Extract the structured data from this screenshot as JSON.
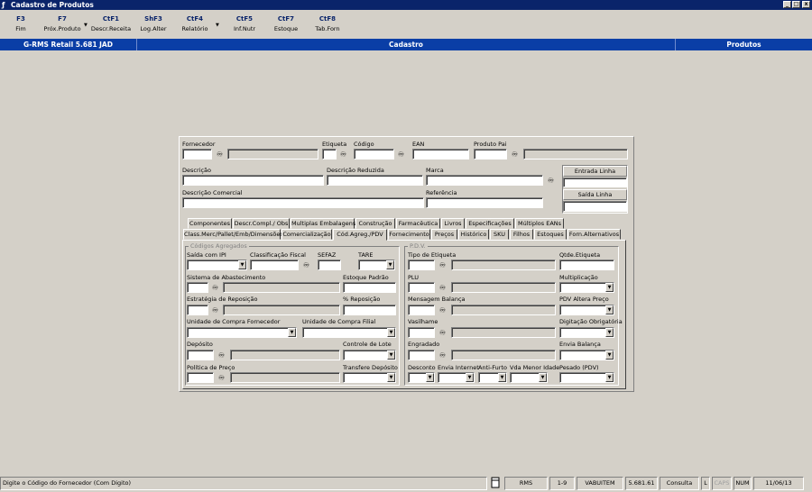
{
  "window": {
    "title": "Cadastro de Produtos",
    "btn_min": "_",
    "btn_max": "□",
    "btn_close": "x"
  },
  "toolbar": [
    {
      "key": "F3",
      "label": "Fim"
    },
    {
      "key": "F7",
      "label": "Próx.Produto"
    },
    {
      "key": "CtF1",
      "label": "Descr.Receita"
    },
    {
      "key": "ShF3",
      "label": "Log.Alter"
    },
    {
      "key": "CtF4",
      "label": "Relatório"
    },
    {
      "key": "CtF5",
      "label": "Inf.Nutr"
    },
    {
      "key": "CtF7",
      "label": "Estoque"
    },
    {
      "key": "CtF8",
      "label": "Tab.Forn"
    }
  ],
  "header": {
    "app": "G-RMS Retail 5.681 JAD",
    "screen": "Cadastro",
    "module": "Produtos"
  },
  "form": {
    "fornecedor": "Fornecedor",
    "etiqueta": "Etiqueta",
    "codigo": "Código",
    "ean": "EAN",
    "produto_pai": "Produto Pai",
    "descricao": "Descrição",
    "descricao_reduzida": "Descrição Reduzida",
    "marca": "Marca",
    "descricao_comercial": "Descrição Comercial",
    "referencia": "Referência",
    "entrada_linha": "Entrada Linha",
    "saida_linha": "Saída Linha"
  },
  "tabs_row1": [
    "Componentes",
    "Descr.Compl./ Obs",
    "Multiplas Embalagens",
    "Construção",
    "Farmacêutica",
    "Livros",
    "Especificações",
    "Múltiplos EANs"
  ],
  "tabs_row2": [
    "Class.Merc/Pallet/Emb/Dimensões",
    "Comercialização",
    "Cód.Agreg./PDV",
    "Fornecimento",
    "Preços",
    "Histórico",
    "SKU",
    "Filhos",
    "Estoques",
    "Forn.Alternativos"
  ],
  "codigos": {
    "title": "Códigos Agregados",
    "saida_ipi": "Saída com IPI",
    "classificacao_fiscal": "Classificação Fiscal",
    "sefaz": "SEFAZ",
    "tare": "TARE",
    "sistema_abastecimento": "Sistema de Abastecimento",
    "estoque_padrao": "Estoque Padrão",
    "estrategia_reposicao": "Estratégia de Reposição",
    "pct_reposicao": "% Reposição",
    "unidade_compra_fornecedor": "Unidade de Compra Fornecedor",
    "unidade_compra_filial": "Unidade de Compra Filial",
    "deposito": "Depósito",
    "controle_lote": "Controle de Lote",
    "politica_preco": "Política de Preço",
    "transfere_deposito": "Transfere Depósito"
  },
  "pdv": {
    "title": "P.D.V.",
    "tipo_etiqueta": "Tipo de Etiqueta",
    "qtde_etiqueta": "Qtde.Etiqueta",
    "plu": "PLU",
    "multiplicacao": "Multiplicação",
    "mensagem_balanca": "Mensagem Balança",
    "pdv_altera_preco": "PDV Altera Preço",
    "vasilhame": "Vasilhame",
    "digitacao_obrigatoria": "Digitação Obrigatória",
    "engradado": "Engradado",
    "envia_balanca": "Envia Balança",
    "desconto": "Desconto",
    "envia_internet": "Envia Internet",
    "anti_furto": "Anti-Furto",
    "vda_menor_idade": "Vda Menor Idade",
    "pesado_pdv": "Pesado (PDV)"
  },
  "statusbar": {
    "message": "Digite o Código do Fornecedor (Com Digito)",
    "system": "RMS",
    "page": "1-9",
    "user": "VABUITEM",
    "version": "5.681.61",
    "mode": "Consulta",
    "l": "L",
    "caps": "CAPS",
    "num": "NUM",
    "date": "11/06/13"
  },
  "colors": {
    "title_bar": "#0a246a",
    "header_bar": "#0a3ea6",
    "window_bg": "#d4d0c8"
  }
}
